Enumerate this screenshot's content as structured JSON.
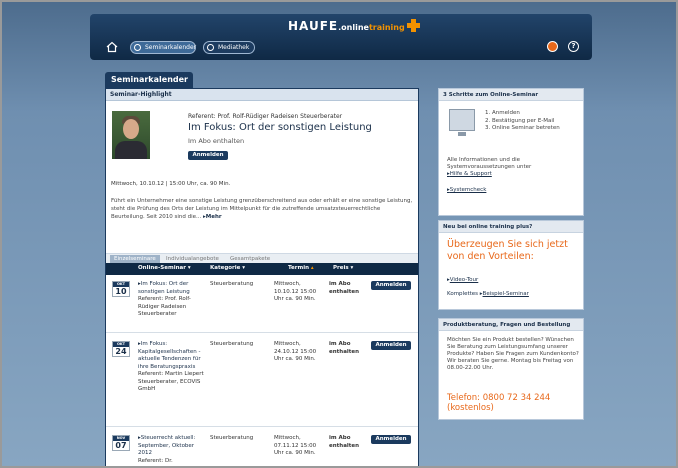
{
  "header": {
    "logo_haufe": "HAUFE",
    "logo_online": ".online",
    "logo_training": "training",
    "tabs": [
      {
        "label": "Seminarkalender",
        "active": true
      },
      {
        "label": "Mediathek",
        "active": false
      }
    ]
  },
  "main": {
    "tab_title": "Seminarkalender",
    "highlight": {
      "section_title": "Seminar-Highlight",
      "referent": "Referent: Prof. Rolf-Rüdiger Radeisen Steuerberater",
      "title": "Im Fokus: Ort der sonstigen Leistung",
      "subtitle": "Im Abo enthalten",
      "button": "Anmelden",
      "date": "Mittwoch, 10.10.12 | 15:00 Uhr, ca. 90 Min.",
      "description": "Führt ein Unternehmer eine sonstige Leistung grenzüberschreitend aus oder erhält er eine sonstige Leistung, steht die Prüfung des Orts der Leistung im Mittelpunkt für die zutreffende umsatzsteuerrechtliche Beurteilung. Seit 2010 sind die...",
      "more": "Mehr"
    },
    "subtabs": [
      "Einzelseminare",
      "Individualangebote",
      "Gesamtpakete"
    ],
    "table": {
      "headers": [
        "Online-Seminar",
        "Kategorie",
        "Termin",
        "Preis"
      ],
      "rows": [
        {
          "month": "OKT",
          "day": "10",
          "title": "Im Fokus: Ort der sonstigen Leistung",
          "referent": "Referent: Prof. Rolf-Rüdiger Radeisen Steuerberater",
          "category": "Steuerberatung",
          "date": "Mittwoch, 10.10.12 15:00 Uhr ca. 90 Min.",
          "price": "im Abo enthalten",
          "button": "Anmelden"
        },
        {
          "month": "OKT",
          "day": "24",
          "title": "Im Fokus: Kapitalgesellschaften - aktuelle Tendenzen für ihre Beratungspraxis",
          "referent": "Referent: Martin Liepert Steuerberater, ECOVIS GmbH",
          "category": "Steuerberatung",
          "date": "Mittwoch, 24.10.12 15:00 Uhr ca. 90 Min.",
          "price": "im Abo enthalten",
          "button": "Anmelden"
        },
        {
          "month": "NOV",
          "day": "07",
          "title": "Steuerrecht aktuell: September, Oktober 2012",
          "referent": "Referent: Dr.",
          "category": "Steuerberatung",
          "date": "Mittwoch, 07.11.12 15:00 Uhr ca. 90 Min.",
          "price": "im Abo enthalten",
          "button": "Anmelden"
        }
      ]
    }
  },
  "sidebar": {
    "box1": {
      "title": "3 Schritte zum Online-Seminar",
      "steps": [
        "1.  Anmelden",
        "2.  Bestätigung per E-Mail",
        "3.  Online Seminar betreten"
      ],
      "info": "Alle Informationen und die Systemvoraussetzungen unter",
      "link1": "Hilfe & Support",
      "link2": "Systemcheck"
    },
    "box2": {
      "title": "Neu bei online training plus?",
      "headline": "Überzeugen Sie sich jetzt von den Vorteilen:",
      "link1": "Video-Tour",
      "link2_prefix": "Komplettes",
      "link2": "Beispiel-Seminar"
    },
    "box3": {
      "title": "Produktberatung, Fragen und Bestellung",
      "info": "Möchten Sie ein Produkt bestellen? Wünschen Sie Beratung zum Leistungsumfang unserer Produkte? Haben Sie Fragen zum Kundenkonto? Wir beraten Sie gerne. Montag bis Freitag von 08.00-22.00 Uhr.",
      "phone": "Telefon: 0800 72 34 244 (kostenlos)"
    }
  }
}
